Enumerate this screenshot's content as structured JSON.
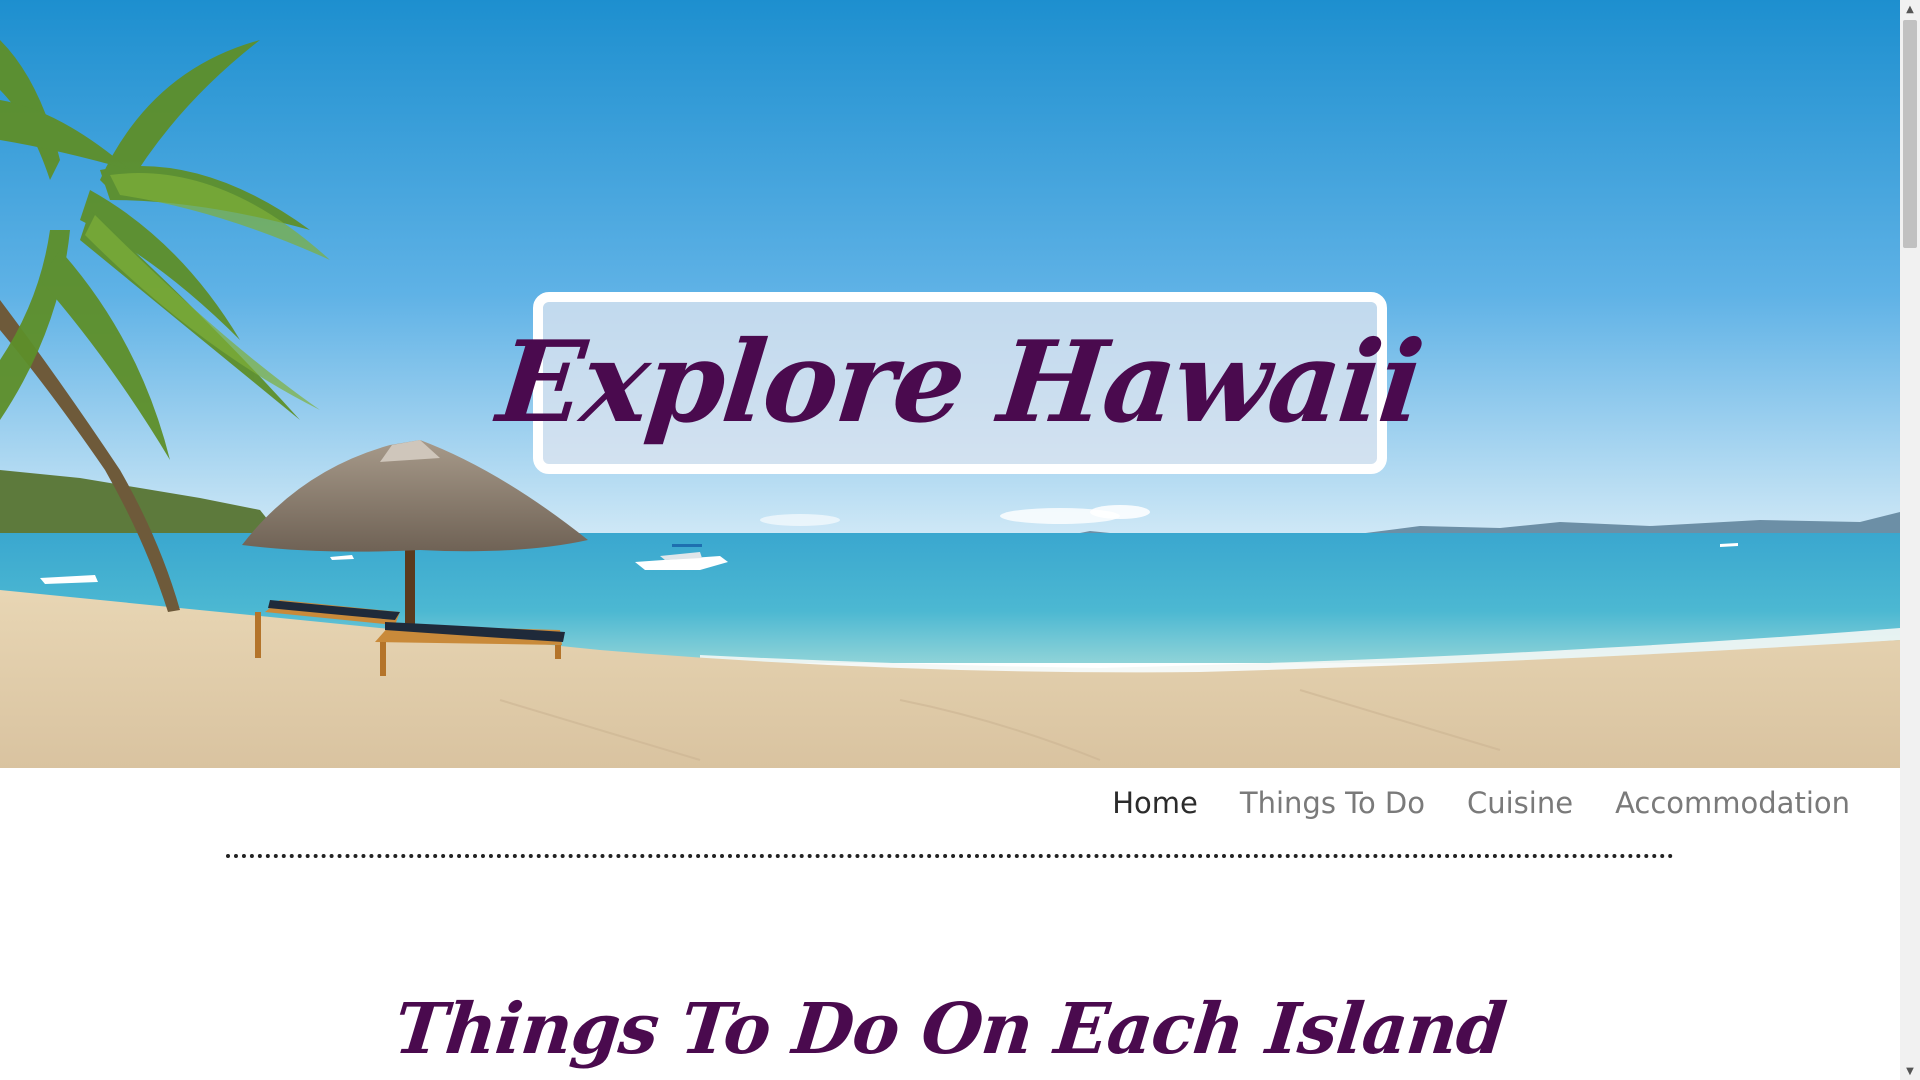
{
  "hero": {
    "title": "Explore Hawaii",
    "image_alt": "Tropical beach with palm tree, thatched umbrella, lounge chairs and boat"
  },
  "nav": {
    "items": [
      {
        "label": "Home",
        "active": true
      },
      {
        "label": "Things To Do",
        "active": false
      },
      {
        "label": "Cuisine",
        "active": false
      },
      {
        "label": "Accommodation",
        "active": false
      }
    ]
  },
  "main": {
    "section_title": "Things To Do On Each Island"
  },
  "scrollbar": {
    "up_icon": "arrow-up-icon",
    "down_icon": "arrow-down-icon"
  },
  "colors": {
    "title": "#4a0a4e",
    "nav_active": "#2b2b2b",
    "nav_inactive": "#7a7a7a"
  }
}
